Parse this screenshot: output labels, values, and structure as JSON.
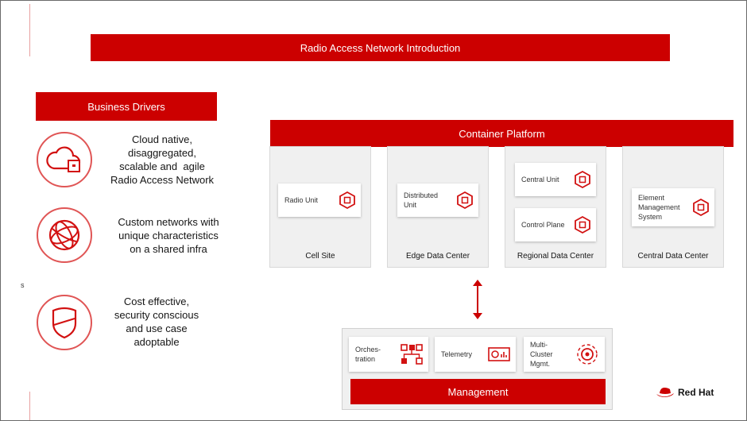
{
  "title": "Radio Access Network Introduction",
  "business_drivers": {
    "heading": "Business Drivers",
    "items": [
      {
        "icon": "cloud-icon",
        "text": "Cloud native,\ndisaggregated,\nscalable and  agile\nRadio Access Network"
      },
      {
        "icon": "network-globe-icon",
        "text": "Custom networks with\nunique characteristics\non a shared infra"
      },
      {
        "icon": "shield-icon",
        "text": "Cost effective,\nsecurity conscious\nand use case\nadoptable"
      }
    ]
  },
  "stray_mark": "s",
  "container_platform": {
    "heading": "Container Platform",
    "sites": [
      {
        "label": "Cell Site",
        "units": [
          "Radio Unit"
        ]
      },
      {
        "label": "Edge Data Center",
        "units": [
          "Distributed\nUnit"
        ]
      },
      {
        "label": "Regional Data Center",
        "units": [
          "Central Unit",
          "Control Plane"
        ]
      },
      {
        "label": "Central Data Center",
        "units": [
          "Element\nManagement\nSystem"
        ]
      }
    ]
  },
  "management": {
    "heading": "Management",
    "items": [
      {
        "label": "Orches-\ntration",
        "icon": "orchestration-icon"
      },
      {
        "label": "Telemetry",
        "icon": "telemetry-icon"
      },
      {
        "label": "Multi-\nCluster\nMgmt.",
        "icon": "multi-cluster-gear-icon"
      }
    ]
  },
  "brand": {
    "name": "Red Hat",
    "color": "#cc0000"
  }
}
